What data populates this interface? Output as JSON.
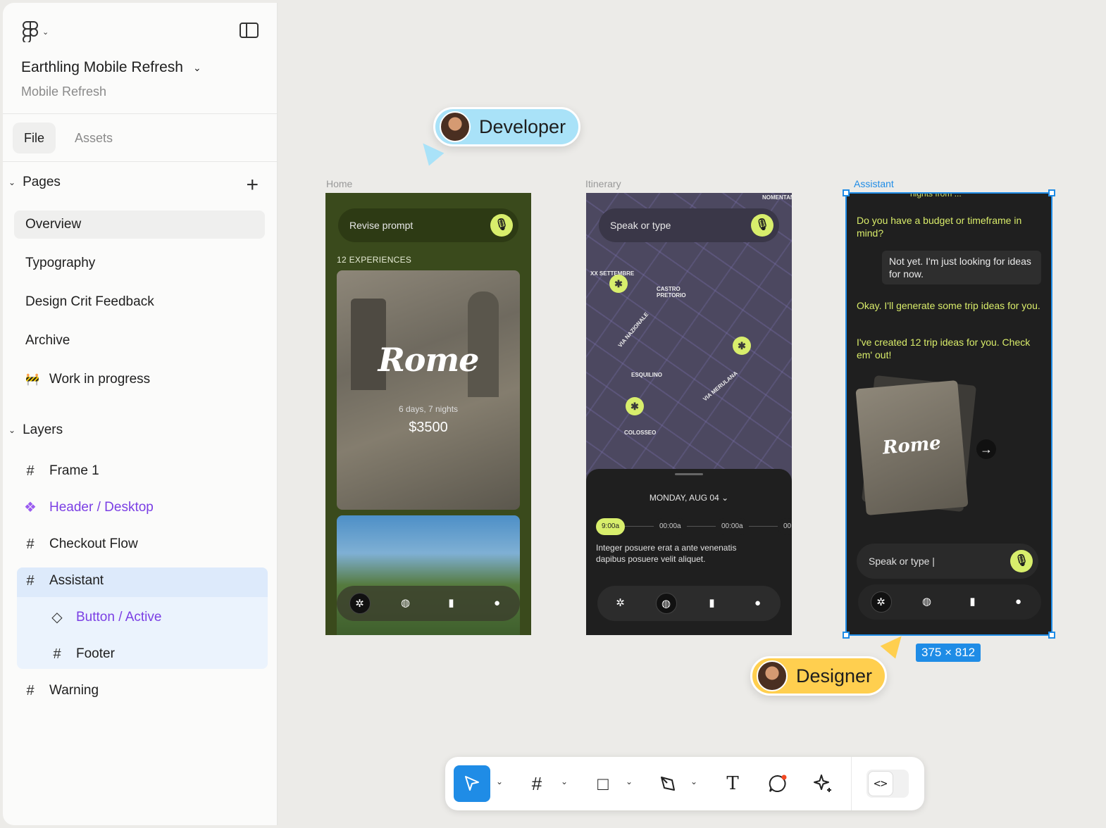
{
  "sidebar": {
    "project_title": "Earthling Mobile Refresh",
    "project_subtitle": "Mobile Refresh",
    "tabs": [
      "File",
      "Assets"
    ],
    "pages_heading": "Pages",
    "pages": [
      "Overview",
      "Typography",
      "Design Crit Feedback",
      "Archive",
      "Work in progress"
    ],
    "wip_icon": "🚧",
    "layers_heading": "Layers",
    "layers": [
      "Frame 1",
      "Header / Desktop",
      "Checkout Flow",
      "Assistant",
      "Button / Active",
      "Footer",
      "Warning"
    ]
  },
  "canvas": {
    "frames": {
      "home": {
        "label": "Home",
        "search_placeholder": "Revise prompt",
        "experiences": "12 EXPERIENCES",
        "card_title": "Rome",
        "card_duration": "6 days, 7 nights",
        "card_price": "$3500"
      },
      "itinerary": {
        "label": "Itinerary",
        "search_placeholder": "Speak or type",
        "date": "MONDAY, AUG 04",
        "times": [
          "9:00a",
          "00:00a",
          "00:00a",
          "00"
        ],
        "description": "Integer posuere erat a ante venenatis dapibus posuere velit aliquet.",
        "map_labels": [
          "NOMENTANA",
          "XX SETTEMBRE",
          "CASTRO PRETORIO",
          "ESQUILINO",
          "COLOSSEO",
          "VIA NAZIONALE",
          "VIA MERULANA"
        ]
      },
      "assistant": {
        "label": "Assistant",
        "cut_text": "nights from ...",
        "msg1": "Do you have a budget or timeframe in mind?",
        "user_msg": "Not yet. I'm just looking for ideas for now.",
        "msg2": "Okay. I'll generate some trip ideas for you.",
        "msg3": "I've created 12 trip ideas for you. Check em' out!",
        "card_title": "Rome",
        "input_text": "Speak or type |"
      }
    },
    "selection_size": "375 × 812",
    "collaborators": [
      "Developer",
      "Designer"
    ],
    "colors": {
      "selection": "#1f8ce6",
      "developer": "#a9e2f8",
      "designer": "#ffcf4f",
      "accent_lime": "#d8ee6c",
      "component_purple": "#7b3fe4"
    }
  },
  "toolbar": {
    "tools": [
      "move-tool",
      "frame-tool",
      "shape-tool",
      "pen-tool",
      "text-tool",
      "comment-tool",
      "ai-tool",
      "dev-mode-toggle"
    ]
  }
}
